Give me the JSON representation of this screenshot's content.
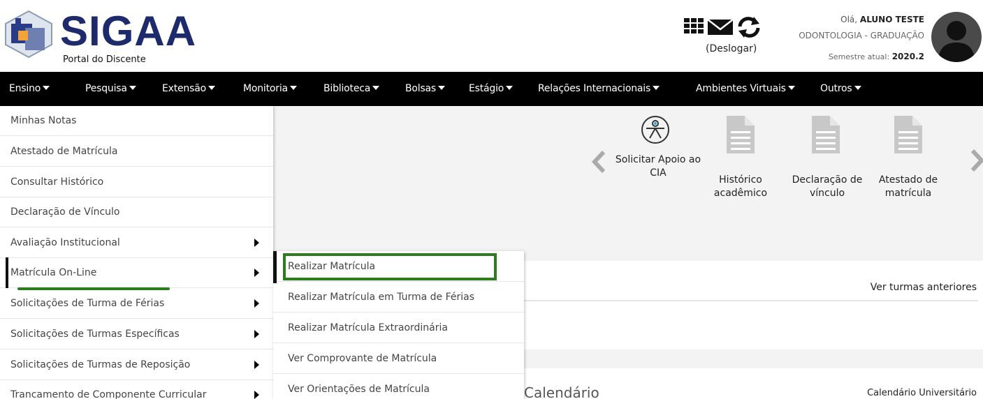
{
  "header": {
    "logo_title": "SIGAA",
    "logo_subtitle": "Portal do Discente",
    "icons": [
      "grid-icon",
      "mail-icon",
      "refresh-icon"
    ],
    "logout_label": "(Deslogar)",
    "greeting_prefix": "Olá, ",
    "user_name": "ALUNO TESTE",
    "course": "ODONTOLOGIA - GRADUAÇÃO",
    "semester_prefix": "Semestre atual: ",
    "semester": "2020.2",
    "brand_color": "#1d2a6b"
  },
  "nav": {
    "items": [
      {
        "label": "Ensino"
      },
      {
        "label": "Pesquisa"
      },
      {
        "label": "Extensão"
      },
      {
        "label": "Monitoria"
      },
      {
        "label": "Biblioteca"
      },
      {
        "label": "Bolsas"
      },
      {
        "label": "Estágio"
      },
      {
        "label": "Relações Internacionais"
      },
      {
        "label": "Ambientes Virtuais"
      },
      {
        "label": "Outros"
      }
    ]
  },
  "ensino_menu": {
    "items": [
      {
        "label": "Minhas Notas",
        "has_submenu": false
      },
      {
        "label": "Atestado de Matrícula",
        "has_submenu": false
      },
      {
        "label": "Consultar Histórico",
        "has_submenu": false
      },
      {
        "label": "Declaração de Vínculo",
        "has_submenu": false
      },
      {
        "label": "Avaliação Institucional",
        "has_submenu": true
      },
      {
        "label": "Matrícula On-Line",
        "has_submenu": true,
        "active": true
      },
      {
        "label": "Solicitações de Turma de Férias",
        "has_submenu": true
      },
      {
        "label": "Solicitações de Turmas Específicas",
        "has_submenu": true
      },
      {
        "label": "Solicitações de Turmas de Reposição",
        "has_submenu": true
      },
      {
        "label": "Trancamento de Componente Curricular",
        "has_submenu": true
      }
    ]
  },
  "matricula_submenu": {
    "items": [
      {
        "label": "Realizar Matrícula",
        "highlighted": true
      },
      {
        "label": "Realizar Matrícula em Turma de Férias"
      },
      {
        "label": "Realizar Matrícula Extraordinária"
      },
      {
        "label": "Ver Comprovante de Matrícula"
      },
      {
        "label": "Ver Orientações de Matrícula"
      }
    ],
    "highlight_color": "#2d7d1f"
  },
  "quick_access": {
    "items": [
      {
        "label": "Solicitar Apoio ao CIA",
        "icon": "accessibility-icon"
      },
      {
        "label": "Histórico acadêmico",
        "icon": "document-icon"
      },
      {
        "label": "Declaração de vínculo",
        "icon": "document-icon"
      },
      {
        "label": "Atestado de matrícula",
        "icon": "document-icon"
      }
    ]
  },
  "main": {
    "ver_turmas_anteriores": "Ver turmas anteriores",
    "calendar_title": "Calendário",
    "calendar_link": "Calendário Universitário"
  }
}
